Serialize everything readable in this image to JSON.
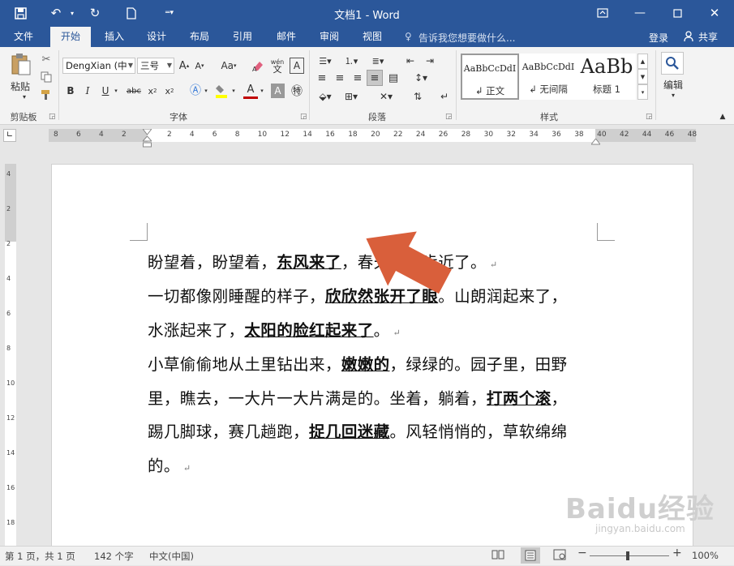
{
  "title_bar": {
    "title": "文档1 - Word",
    "qat_icons": [
      "save-icon",
      "undo-icon",
      "redo-icon",
      "new-document-icon",
      "customize-icon"
    ],
    "window_controls": [
      "ribbon-display-icon",
      "minimize-icon",
      "maximize-icon",
      "close-icon"
    ]
  },
  "tabs": [
    "文件",
    "开始",
    "插入",
    "设计",
    "布局",
    "引用",
    "邮件",
    "审阅",
    "视图"
  ],
  "active_tab": "开始",
  "tell_me": "告诉我您想要做什么...",
  "signin": "登录",
  "share": "共享",
  "clipboard": {
    "paste": "粘贴",
    "label": "剪贴板"
  },
  "font": {
    "name": "DengXian (中",
    "size": "三号",
    "label": "字体",
    "phonetic_top": "wén",
    "phonetic_bottom": "文",
    "case_label": "Aa"
  },
  "paragraph": {
    "label": "段落"
  },
  "styles": {
    "label": "样式",
    "items": [
      {
        "sample": "AaBbCcDdI",
        "name": "↲ 正文"
      },
      {
        "sample": "AaBbCcDdI",
        "name": "↲ 无间隔"
      },
      {
        "sample": "AaBb",
        "name": "标题 1"
      }
    ]
  },
  "editing": {
    "label": "编辑"
  },
  "ruler": {
    "h_ticks_left": [
      "8",
      "6",
      "4",
      "2"
    ],
    "h_ticks_right": [
      "2",
      "4",
      "6",
      "8",
      "10",
      "12",
      "14",
      "16",
      "18",
      "20",
      "22",
      "24",
      "26",
      "28",
      "30",
      "32",
      "34",
      "36",
      "38",
      "40",
      "42",
      "44",
      "46",
      "48"
    ],
    "v_ticks": [
      "4",
      "2",
      "2",
      "4",
      "6",
      "8",
      "10",
      "12",
      "14",
      "16",
      "18"
    ]
  },
  "document": {
    "paragraphs": [
      [
        {
          "t": "盼望着，盼望着，",
          "b": false
        },
        {
          "t": "东风来了",
          "b": true
        },
        {
          "t": "，春天的脚步近了。",
          "b": false
        }
      ],
      [
        {
          "t": "一切都像刚睡醒的样子，",
          "b": false
        },
        {
          "t": "欣欣然张开了眼",
          "b": true
        },
        {
          "t": "。山朗润起来了，",
          "b": false
        }
      ],
      [
        {
          "t": "水涨起来了，",
          "b": false
        },
        {
          "t": "太阳的脸红起来了",
          "b": true
        },
        {
          "t": "。",
          "b": false
        }
      ],
      [
        {
          "t": "小草偷偷地从土里钻出来，",
          "b": false
        },
        {
          "t": "嫩嫩的",
          "b": true
        },
        {
          "t": "，绿绿的。园子里，田野",
          "b": false
        }
      ],
      [
        {
          "t": "里，瞧去，一大片一大片满是的。坐着，躺着，",
          "b": false
        },
        {
          "t": "打两个滚",
          "b": true
        },
        {
          "t": "，",
          "b": false
        }
      ],
      [
        {
          "t": "踢几脚球，赛几趟跑，",
          "b": false
        },
        {
          "t": "捉几回迷藏",
          "b": true
        },
        {
          "t": "。风轻悄悄的，草软绵绵",
          "b": false
        }
      ],
      [
        {
          "t": "的。",
          "b": false
        }
      ]
    ],
    "paragraph_marks": [
      true,
      false,
      true,
      false,
      false,
      false,
      true
    ],
    "pilcrow": "↵"
  },
  "status": {
    "page": "第 1 页，共 1 页",
    "words": "142 个字",
    "lang": "中文(中国)",
    "zoom": "100%"
  },
  "watermark": {
    "brand": "Baidu经验",
    "url": "jingyan.baidu.com"
  },
  "colors": {
    "brand": "#2b579a",
    "arrow": "#d95f3b"
  }
}
